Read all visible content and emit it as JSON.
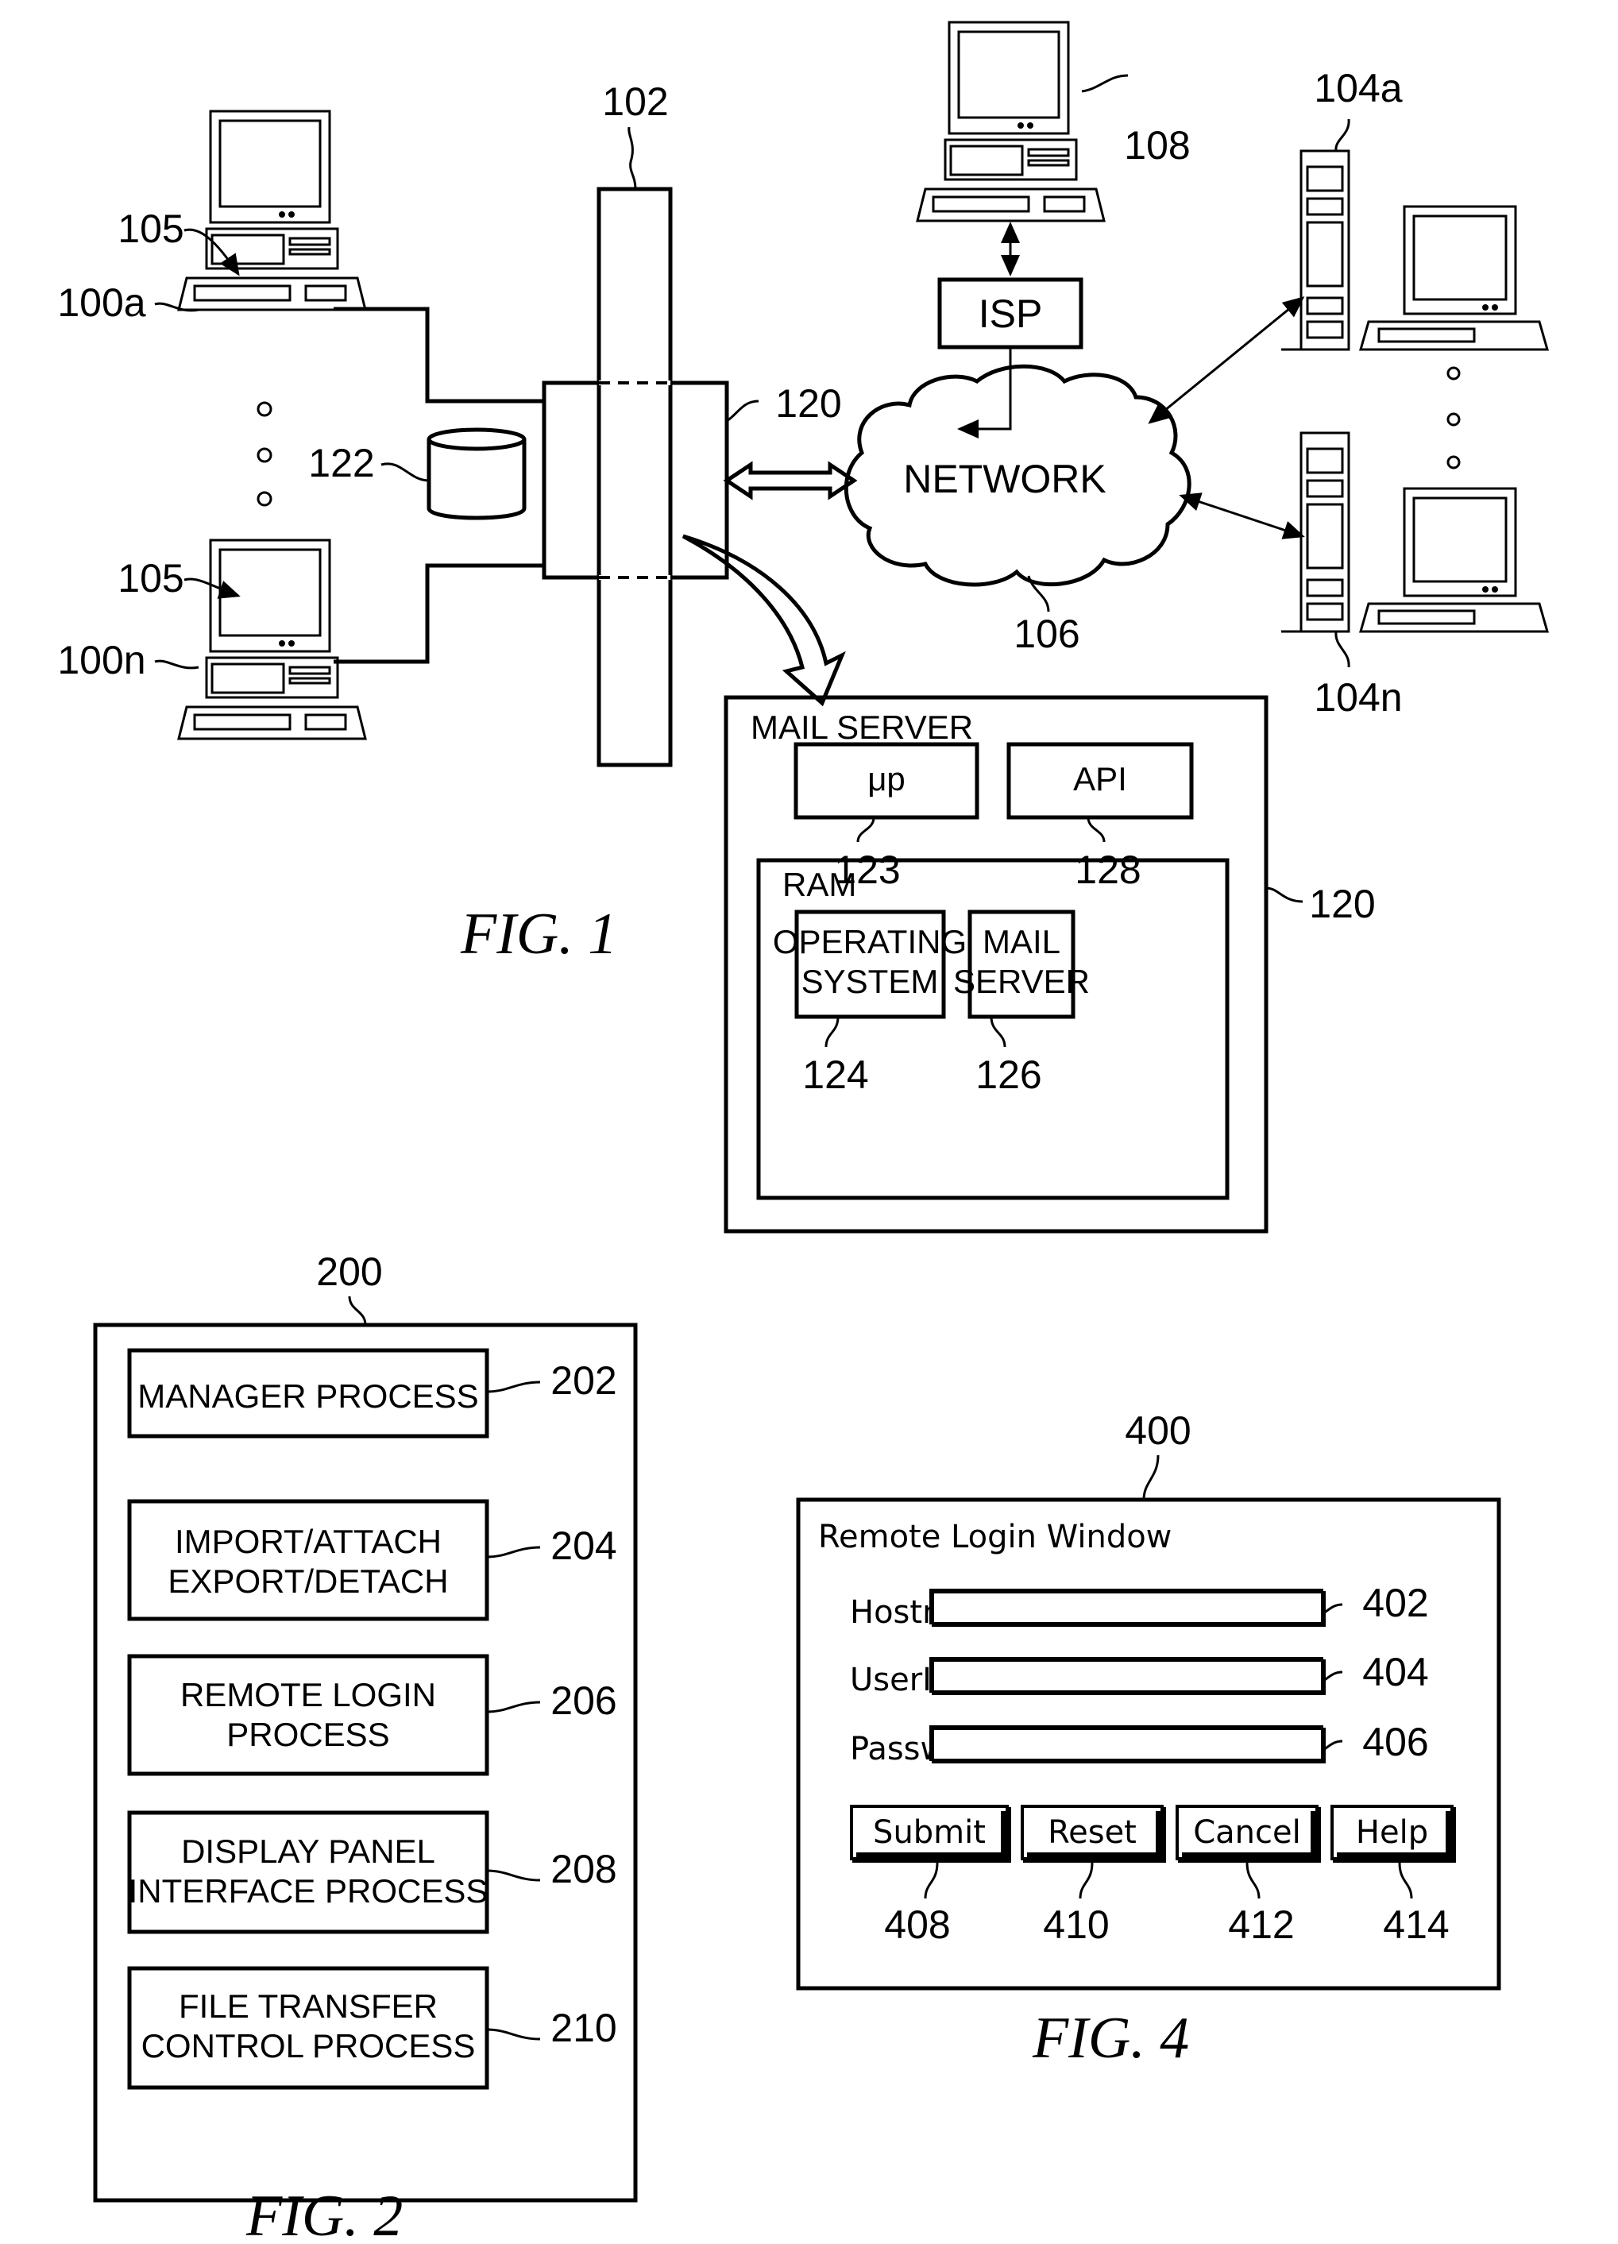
{
  "fig1": {
    "caption": "FIG.  1",
    "labels": {
      "bus": "102",
      "client_top_screen": "105",
      "client_top": "100a",
      "client_bottom_screen": "105",
      "client_bottom": "100n",
      "database": "122",
      "server_node": "120",
      "remote_pc": "108",
      "isp": "ISP",
      "network": "NETWORK",
      "network_ref": "106",
      "server_top": "104a",
      "server_bottom": "104n"
    },
    "mail_server": {
      "title": "MAIL SERVER",
      "ref": "120",
      "microprocessor": "μp",
      "microprocessor_ref": "123",
      "api": "API",
      "api_ref": "128",
      "ram": "RAM",
      "os_line1": "OPERATING",
      "os_line2": "SYSTEM",
      "os_ref": "124",
      "mailsrv_line1": "MAIL",
      "mailsrv_line2": "SERVER",
      "mailsrv_ref": "126"
    }
  },
  "fig2": {
    "caption": "FIG.  2",
    "ref": "200",
    "items": [
      {
        "line1": "MANAGER  PROCESS",
        "line2": "",
        "ref": "202"
      },
      {
        "line1": "IMPORT/ATTACH",
        "line2": "EXPORT/DETACH",
        "ref": "204"
      },
      {
        "line1": "REMOTE  LOGIN",
        "line2": "PROCESS",
        "ref": "206"
      },
      {
        "line1": "DISPLAY  PANEL",
        "line2": "INTERFACE  PROCESS",
        "ref": "208"
      },
      {
        "line1": "FILE  TRANSFER",
        "line2": "CONTROL  PROCESS",
        "ref": "210"
      }
    ]
  },
  "fig4": {
    "caption": "FIG.  4",
    "ref": "400",
    "window_title": "Remote  Login  Window",
    "fields": [
      {
        "label": "Hostname",
        "value": "",
        "ref": "402"
      },
      {
        "label": "UserID",
        "value": "",
        "ref": "404"
      },
      {
        "label": "Password",
        "value": "",
        "ref": "406"
      }
    ],
    "buttons": [
      {
        "label": "Submit",
        "ref": "408"
      },
      {
        "label": "Reset",
        "ref": "410"
      },
      {
        "label": "Cancel",
        "ref": "412"
      },
      {
        "label": "Help",
        "ref": "414"
      }
    ]
  }
}
